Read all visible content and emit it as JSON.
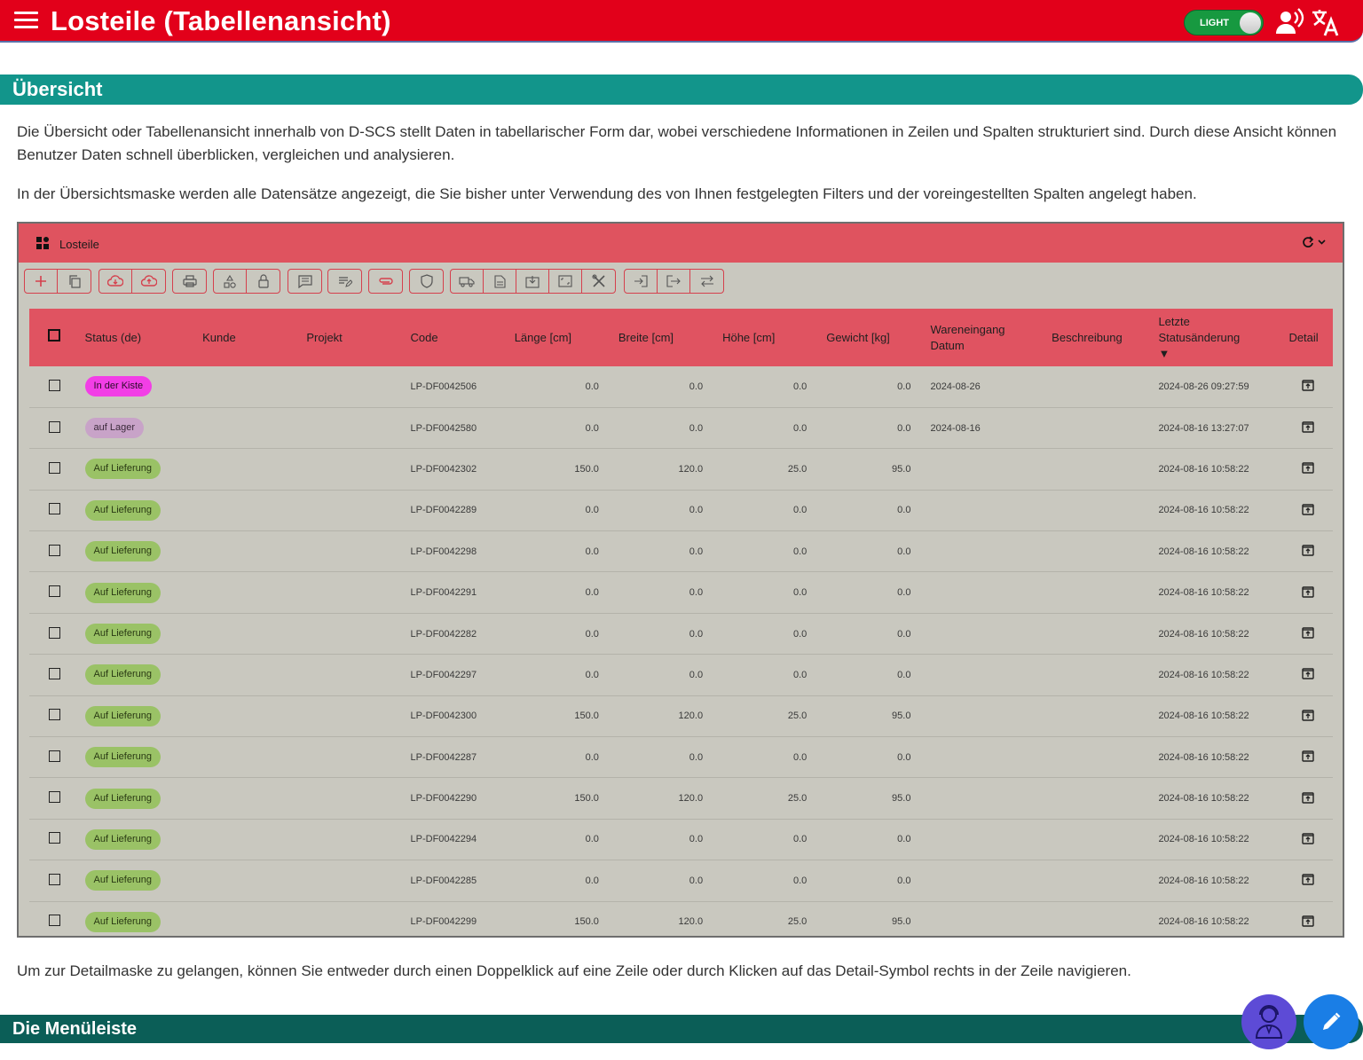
{
  "header": {
    "title": "Losteile (Tabellenansicht)",
    "theme_label": "LIGHT",
    "icons": [
      "menu-icon",
      "voice-icon",
      "translate-icon"
    ]
  },
  "section1": {
    "heading": "Übersicht",
    "para1": "Die Übersicht oder Tabellenansicht innerhalb von D-SCS stellt Daten in tabellarischer Form dar, wobei verschiedene Informationen in Zeilen und Spalten strukturiert sind. Durch diese Ansicht können Benutzer Daten schnell überblicken, vergleichen und analysieren.",
    "para2": "In der Übersichtsmaske werden alle Datensätze angezeigt, die Sie bisher unter Verwendung des von Ihnen festgelegten Filters und der voreingestellten Spalten angelegt haben.",
    "para3": "Um zur Detailmaske zu gelangen, können Sie entweder durch einen Doppelklick auf eine Zeile oder durch Klicken auf das Detail-Symbol rechts in der Zeile navigieren."
  },
  "panel": {
    "title": "Losteile",
    "columns": [
      "Status (de)",
      "Kunde",
      "Projekt",
      "Code",
      "Länge [cm]",
      "Breite [cm]",
      "Höhe [cm]",
      "Gewicht [kg]",
      "Wareneingang Datum",
      "Beschreibung",
      "Letzte Statusänderung",
      "Detail"
    ],
    "sort_indicator": "▼",
    "rows": [
      {
        "status": "In der Kiste",
        "code": "LP-DF0042506",
        "laenge": "0.0",
        "breite": "0.0",
        "hoehe": "0.0",
        "gewicht": "0.0",
        "wareneingang": "2024-08-26",
        "letzte": "2024-08-26 09:27:59"
      },
      {
        "status": "auf Lager",
        "code": "LP-DF0042580",
        "laenge": "0.0",
        "breite": "0.0",
        "hoehe": "0.0",
        "gewicht": "0.0",
        "wareneingang": "2024-08-16",
        "letzte": "2024-08-16 13:27:07"
      },
      {
        "status": "Auf Lieferung",
        "code": "LP-DF0042302",
        "laenge": "150.0",
        "breite": "120.0",
        "hoehe": "25.0",
        "gewicht": "95.0",
        "wareneingang": "",
        "letzte": "2024-08-16 10:58:22"
      },
      {
        "status": "Auf Lieferung",
        "code": "LP-DF0042289",
        "laenge": "0.0",
        "breite": "0.0",
        "hoehe": "0.0",
        "gewicht": "0.0",
        "wareneingang": "",
        "letzte": "2024-08-16 10:58:22"
      },
      {
        "status": "Auf Lieferung",
        "code": "LP-DF0042298",
        "laenge": "0.0",
        "breite": "0.0",
        "hoehe": "0.0",
        "gewicht": "0.0",
        "wareneingang": "",
        "letzte": "2024-08-16 10:58:22"
      },
      {
        "status": "Auf Lieferung",
        "code": "LP-DF0042291",
        "laenge": "0.0",
        "breite": "0.0",
        "hoehe": "0.0",
        "gewicht": "0.0",
        "wareneingang": "",
        "letzte": "2024-08-16 10:58:22"
      },
      {
        "status": "Auf Lieferung",
        "code": "LP-DF0042282",
        "laenge": "0.0",
        "breite": "0.0",
        "hoehe": "0.0",
        "gewicht": "0.0",
        "wareneingang": "",
        "letzte": "2024-08-16 10:58:22"
      },
      {
        "status": "Auf Lieferung",
        "code": "LP-DF0042297",
        "laenge": "0.0",
        "breite": "0.0",
        "hoehe": "0.0",
        "gewicht": "0.0",
        "wareneingang": "",
        "letzte": "2024-08-16 10:58:22"
      },
      {
        "status": "Auf Lieferung",
        "code": "LP-DF0042300",
        "laenge": "150.0",
        "breite": "120.0",
        "hoehe": "25.0",
        "gewicht": "95.0",
        "wareneingang": "",
        "letzte": "2024-08-16 10:58:22"
      },
      {
        "status": "Auf Lieferung",
        "code": "LP-DF0042287",
        "laenge": "0.0",
        "breite": "0.0",
        "hoehe": "0.0",
        "gewicht": "0.0",
        "wareneingang": "",
        "letzte": "2024-08-16 10:58:22"
      },
      {
        "status": "Auf Lieferung",
        "code": "LP-DF0042290",
        "laenge": "150.0",
        "breite": "120.0",
        "hoehe": "25.0",
        "gewicht": "95.0",
        "wareneingang": "",
        "letzte": "2024-08-16 10:58:22"
      },
      {
        "status": "Auf Lieferung",
        "code": "LP-DF0042294",
        "laenge": "0.0",
        "breite": "0.0",
        "hoehe": "0.0",
        "gewicht": "0.0",
        "wareneingang": "",
        "letzte": "2024-08-16 10:58:22"
      },
      {
        "status": "Auf Lieferung",
        "code": "LP-DF0042285",
        "laenge": "0.0",
        "breite": "0.0",
        "hoehe": "0.0",
        "gewicht": "0.0",
        "wareneingang": "",
        "letzte": "2024-08-16 10:58:22"
      },
      {
        "status": "Auf Lieferung",
        "code": "LP-DF0042299",
        "laenge": "150.0",
        "breite": "120.0",
        "hoehe": "25.0",
        "gewicht": "95.0",
        "wareneingang": "",
        "letzte": "2024-08-16 10:58:22"
      }
    ],
    "status_colors": {
      "In der Kiste": {
        "bg": "#f23ee6",
        "fg": "#2a0b27"
      },
      "auf Lager": {
        "bg": "#c8a3c8",
        "fg": "#3a2a3a"
      },
      "Auf Lieferung": {
        "bg": "#9ac266",
        "fg": "#2a3a14"
      }
    }
  },
  "section2": {
    "heading": "Die Menüleiste"
  },
  "colors": {
    "header_red": "#e2001a",
    "section_teal": "#12958b",
    "section_dark_teal": "#0b5e57",
    "panel_bg": "#c9c8bf",
    "panel_header": "#df535f",
    "fab_support": "#5d4bd6",
    "fab_edit": "#1a7ee6"
  }
}
